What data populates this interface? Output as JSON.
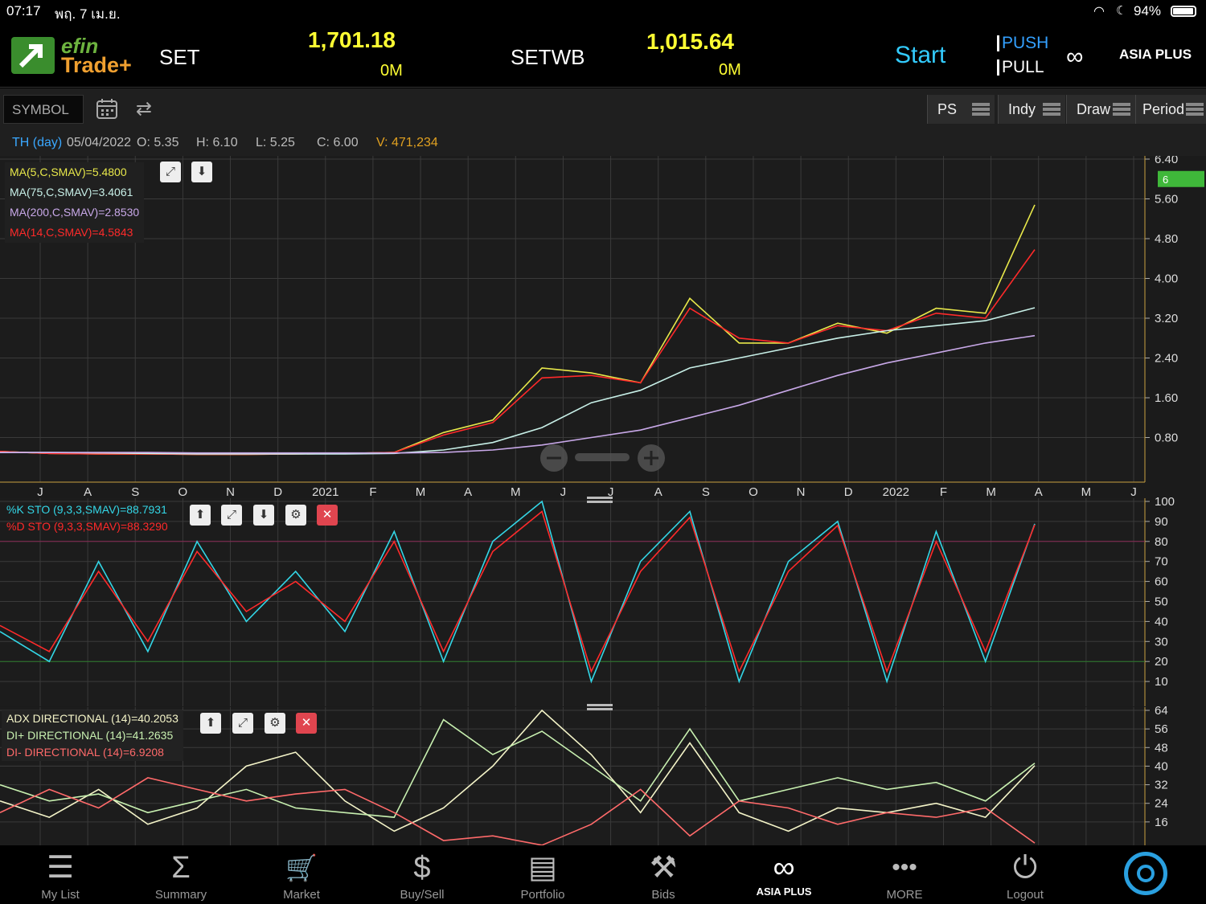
{
  "status_bar": {
    "time": "07:17",
    "date": "พฤ. 7 เม.ย.",
    "battery": "94%"
  },
  "header": {
    "brand_top": "efin",
    "brand_bottom": "Trade+",
    "set_label": "SET",
    "set_value": "1,701.18",
    "set_volume": "0M",
    "setwb_label": "SETWB",
    "setwb_value": "1,015.64",
    "setwb_volume": "0M",
    "start_label": "Start",
    "push_label": "PUSH",
    "pull_label": "PULL",
    "broker_label": "ASIA PLUS"
  },
  "toolbar": {
    "symbol_placeholder": "SYMBOL",
    "ps_label": "PS",
    "indy_label": "Indy",
    "draw_label": "Draw",
    "period_label": "Period"
  },
  "info_bar": {
    "symbol_period": "TH (day)",
    "date": "05/04/2022",
    "open": "O: 5.35",
    "high": "H: 6.10",
    "low": "L: 5.25",
    "close": "C: 6.00",
    "volume": "V: 471,234"
  },
  "price_legend": [
    {
      "text": "MA(5,C,SMAV)=5.4800",
      "color": "#e8e84a"
    },
    {
      "text": "MA(75,C,SMAV)=3.4061",
      "color": "#c8f0e8"
    },
    {
      "text": "MA(200,C,SMAV)=2.8530",
      "color": "#c8a8e8"
    },
    {
      "text": "MA(14,C,SMAV)=4.5843",
      "color": "#ff2a2a"
    }
  ],
  "sto_legend": [
    {
      "text": "%K STO (9,3,3,SMAV)=88.7931",
      "color": "#33d6e6"
    },
    {
      "text": "%D STO (9,3,3,SMAV)=88.3290",
      "color": "#ff2a2a"
    }
  ],
  "adx_legend": [
    {
      "text": "ADX DIRECTIONAL (14)=40.2053",
      "color": "#f4f4c8"
    },
    {
      "text": "DI+ DIRECTIONAL (14)=41.2635",
      "color": "#c8f0b0"
    },
    {
      "text": "DI- DIRECTIONAL (14)=6.9208",
      "color": "#ff6a6a"
    }
  ],
  "chart_data": [
    {
      "type": "line",
      "title": "TH (day)",
      "series": [
        {
          "name": "MA(5,C,SMAV)",
          "color": "#e8e84a",
          "x": [
            "J",
            "A",
            "S",
            "O",
            "N",
            "D",
            "2021",
            "F",
            "M",
            "A",
            "M",
            "J",
            "J",
            "A",
            "S",
            "O",
            "N",
            "D",
            "2022",
            "F",
            "M",
            "A"
          ],
          "values": [
            0.52,
            0.48,
            0.47,
            0.47,
            0.46,
            0.46,
            0.47,
            0.48,
            0.5,
            0.9,
            1.15,
            2.2,
            2.1,
            1.9,
            3.6,
            2.7,
            2.7,
            3.1,
            2.9,
            3.4,
            3.3,
            5.48
          ]
        },
        {
          "name": "MA(14,C,SMAV)",
          "color": "#ff2a2a",
          "x": [
            "J",
            "A",
            "S",
            "O",
            "N",
            "D",
            "2021",
            "F",
            "M",
            "A",
            "M",
            "J",
            "J",
            "A",
            "S",
            "O",
            "N",
            "D",
            "2022",
            "F",
            "M",
            "A"
          ],
          "values": [
            0.52,
            0.48,
            0.47,
            0.47,
            0.46,
            0.46,
            0.47,
            0.48,
            0.5,
            0.85,
            1.1,
            2.0,
            2.05,
            1.9,
            3.4,
            2.8,
            2.7,
            3.05,
            2.95,
            3.3,
            3.2,
            4.58
          ]
        },
        {
          "name": "MA(75,C,SMAV)",
          "color": "#c8f0e8",
          "x": [
            "J",
            "A",
            "S",
            "O",
            "N",
            "D",
            "2021",
            "F",
            "M",
            "A",
            "M",
            "J",
            "J",
            "A",
            "S",
            "O",
            "N",
            "D",
            "2022",
            "F",
            "M",
            "A"
          ],
          "values": [
            0.5,
            0.5,
            0.49,
            0.48,
            0.47,
            0.47,
            0.47,
            0.47,
            0.48,
            0.55,
            0.7,
            1.0,
            1.5,
            1.75,
            2.2,
            2.4,
            2.6,
            2.8,
            2.95,
            3.05,
            3.15,
            3.41
          ]
        },
        {
          "name": "MA(200,C,SMAV)",
          "color": "#c8a8e8",
          "x": [
            "J",
            "A",
            "S",
            "O",
            "N",
            "D",
            "2021",
            "F",
            "M",
            "A",
            "M",
            "J",
            "J",
            "A",
            "S",
            "O",
            "N",
            "D",
            "2022",
            "F",
            "M",
            "A"
          ],
          "values": [
            0.5,
            0.5,
            0.5,
            0.5,
            0.49,
            0.49,
            0.49,
            0.49,
            0.49,
            0.5,
            0.55,
            0.65,
            0.8,
            0.95,
            1.2,
            1.45,
            1.75,
            2.05,
            2.3,
            2.5,
            2.7,
            2.85
          ]
        }
      ],
      "ylim": [
        0,
        6.4
      ],
      "y_ticks": [
        "6.40",
        "5.60",
        "4.80",
        "4.00",
        "3.20",
        "2.40",
        "1.60",
        "0.80"
      ],
      "last_price_badge": "6",
      "x_ticks": [
        "J",
        "A",
        "S",
        "O",
        "N",
        "D",
        "2021",
        "F",
        "M",
        "A",
        "M",
        "J",
        "J",
        "A",
        "S",
        "O",
        "N",
        "D",
        "2022",
        "F",
        "M",
        "A",
        "M",
        "J"
      ]
    },
    {
      "type": "line",
      "series": [
        {
          "name": "%K STO (9,3,3,SMAV)",
          "color": "#33d6e6",
          "x": [
            "J",
            "A",
            "S",
            "O",
            "N",
            "D",
            "2021",
            "F",
            "M",
            "A",
            "M",
            "J",
            "J",
            "A",
            "S",
            "O",
            "N",
            "D",
            "2022",
            "F",
            "M",
            "A"
          ],
          "values": [
            35,
            20,
            70,
            25,
            80,
            40,
            65,
            35,
            85,
            20,
            80,
            100,
            10,
            70,
            95,
            10,
            70,
            90,
            10,
            85,
            20,
            88.79
          ]
        },
        {
          "name": "%D STO (9,3,3,SMAV)",
          "color": "#ff2a2a",
          "x": [
            "J",
            "A",
            "S",
            "O",
            "N",
            "D",
            "2021",
            "F",
            "M",
            "A",
            "M",
            "J",
            "J",
            "A",
            "S",
            "O",
            "N",
            "D",
            "2022",
            "F",
            "M",
            "A"
          ],
          "values": [
            38,
            25,
            65,
            30,
            75,
            45,
            60,
            40,
            80,
            25,
            75,
            95,
            15,
            65,
            92,
            15,
            65,
            88,
            15,
            80,
            25,
            88.33
          ]
        }
      ],
      "ylim": [
        0,
        100
      ],
      "y_ticks": [
        "100",
        "90",
        "80",
        "70",
        "60",
        "50",
        "40",
        "30",
        "20",
        "10"
      ]
    },
    {
      "type": "line",
      "series": [
        {
          "name": "ADX DIRECTIONAL (14)",
          "color": "#f4f4c8",
          "x": [
            "J",
            "A",
            "S",
            "O",
            "N",
            "D",
            "2021",
            "F",
            "M",
            "A",
            "M",
            "J",
            "J",
            "A",
            "S",
            "O",
            "N",
            "D",
            "2022",
            "F",
            "M",
            "A"
          ],
          "values": [
            25,
            18,
            30,
            15,
            22,
            40,
            46,
            25,
            12,
            22,
            40,
            64,
            45,
            20,
            50,
            20,
            12,
            22,
            20,
            24,
            18,
            40.21
          ]
        },
        {
          "name": "DI+ DIRECTIONAL (14)",
          "color": "#c8f0b0",
          "x": [
            "J",
            "A",
            "S",
            "O",
            "N",
            "D",
            "2021",
            "F",
            "M",
            "A",
            "M",
            "J",
            "J",
            "A",
            "S",
            "O",
            "N",
            "D",
            "2022",
            "F",
            "M",
            "A"
          ],
          "values": [
            32,
            25,
            28,
            20,
            25,
            30,
            22,
            20,
            18,
            60,
            45,
            55,
            40,
            25,
            56,
            25,
            30,
            35,
            30,
            33,
            25,
            41.26
          ]
        },
        {
          "name": "DI- DIRECTIONAL (14)",
          "color": "#ff6a6a",
          "x": [
            "J",
            "A",
            "S",
            "O",
            "N",
            "D",
            "2021",
            "F",
            "M",
            "A",
            "M",
            "J",
            "J",
            "A",
            "S",
            "O",
            "N",
            "D",
            "2022",
            "F",
            "M",
            "A"
          ],
          "values": [
            20,
            30,
            22,
            35,
            30,
            25,
            28,
            30,
            20,
            8,
            10,
            6,
            15,
            30,
            10,
            25,
            22,
            15,
            20,
            18,
            22,
            6.92
          ]
        }
      ],
      "ylim": [
        8,
        64
      ],
      "y_ticks": [
        "64",
        "56",
        "48",
        "40",
        "32",
        "24",
        "16"
      ]
    }
  ],
  "nav": [
    {
      "label": "My List",
      "icon": "list-icon",
      "glyph": "☰"
    },
    {
      "label": "Summary",
      "icon": "sigma-icon",
      "glyph": "Σ"
    },
    {
      "label": "Market",
      "icon": "cart-icon",
      "glyph": "🛒"
    },
    {
      "label": "Buy/Sell",
      "icon": "buy-sell-icon",
      "glyph": "$"
    },
    {
      "label": "Portfolio",
      "icon": "portfolio-icon",
      "glyph": "▤"
    },
    {
      "label": "Bids",
      "icon": "gavel-icon",
      "glyph": "⚒"
    },
    {
      "label": "ASIA PLUS",
      "icon": "asiaplus-logo-icon",
      "glyph": "∞"
    },
    {
      "label": "MORE",
      "icon": "more-icon",
      "glyph": "•••"
    },
    {
      "label": "Logout",
      "icon": "power-icon",
      "glyph": "⏻"
    }
  ]
}
